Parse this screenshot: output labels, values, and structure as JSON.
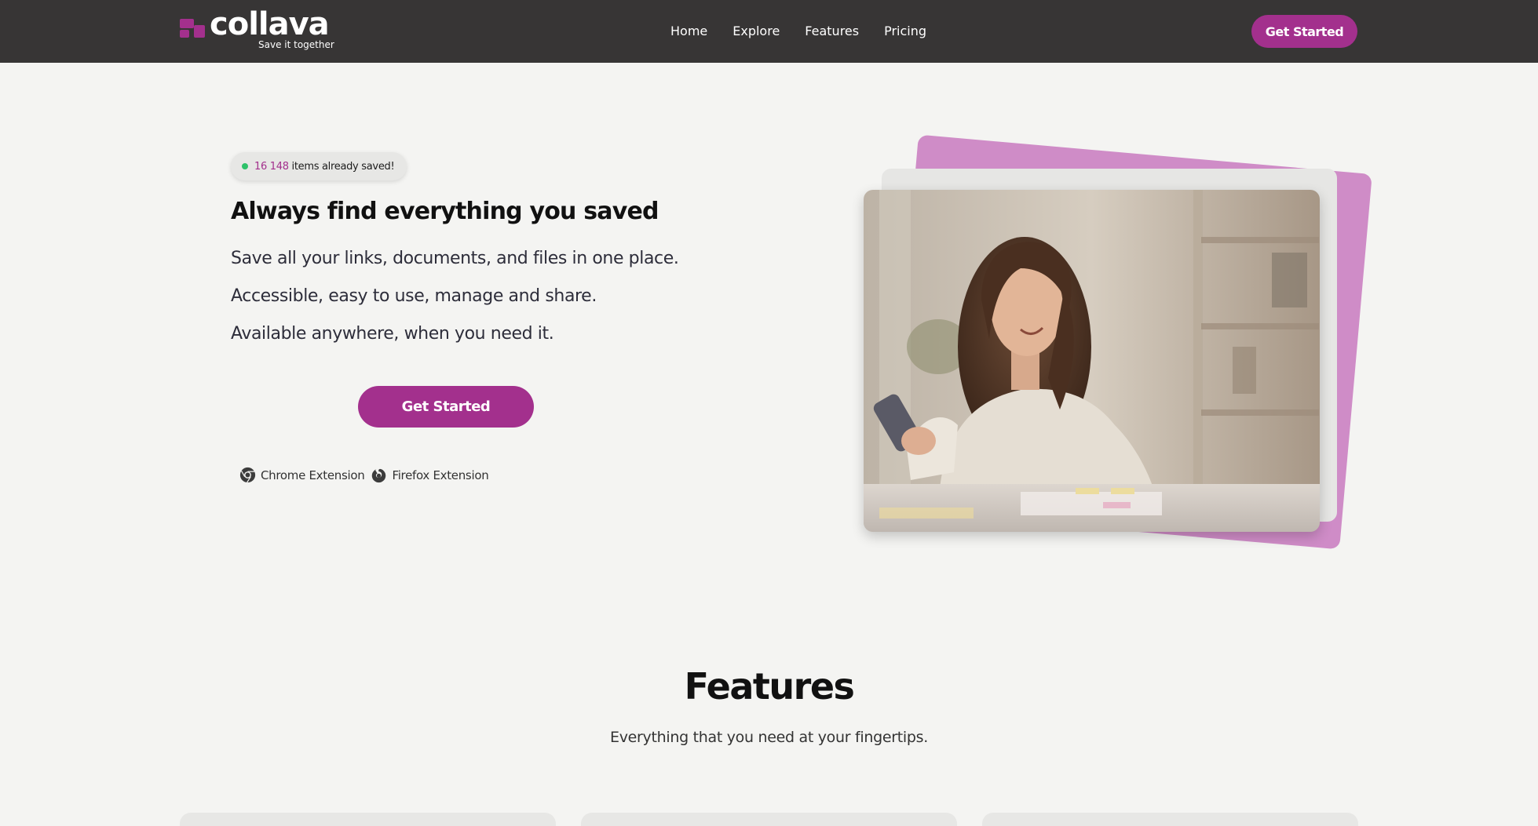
{
  "header": {
    "logo_word": "collava",
    "logo_tagline": "Save it together",
    "nav": [
      {
        "label": "Home"
      },
      {
        "label": "Explore"
      },
      {
        "label": "Features"
      },
      {
        "label": "Pricing"
      }
    ],
    "cta_label": "Get Started"
  },
  "hero": {
    "counter_value": "16 148",
    "counter_suffix": "items already saved!",
    "title": "Always find everything you saved",
    "lines": [
      "Save all your links, documents, and files in one place.",
      "Accessible, easy to use, manage and share.",
      "Available anywhere, when you need it."
    ],
    "cta_label": "Get Started",
    "extensions": [
      {
        "label": "Chrome Extension",
        "icon": "chrome-icon"
      },
      {
        "label": "Firefox Extension",
        "icon": "firefox-icon"
      }
    ],
    "image": "woman-with-phone-photo"
  },
  "features": {
    "title": "Features",
    "subtitle": "Everything that you need at your fingertips."
  },
  "colors": {
    "brand": "#a3308d",
    "header_bg": "#373535",
    "page_bg": "#f4f4f2",
    "accent_pink": "#cf8cc7",
    "status_dot": "#2ec26a"
  }
}
